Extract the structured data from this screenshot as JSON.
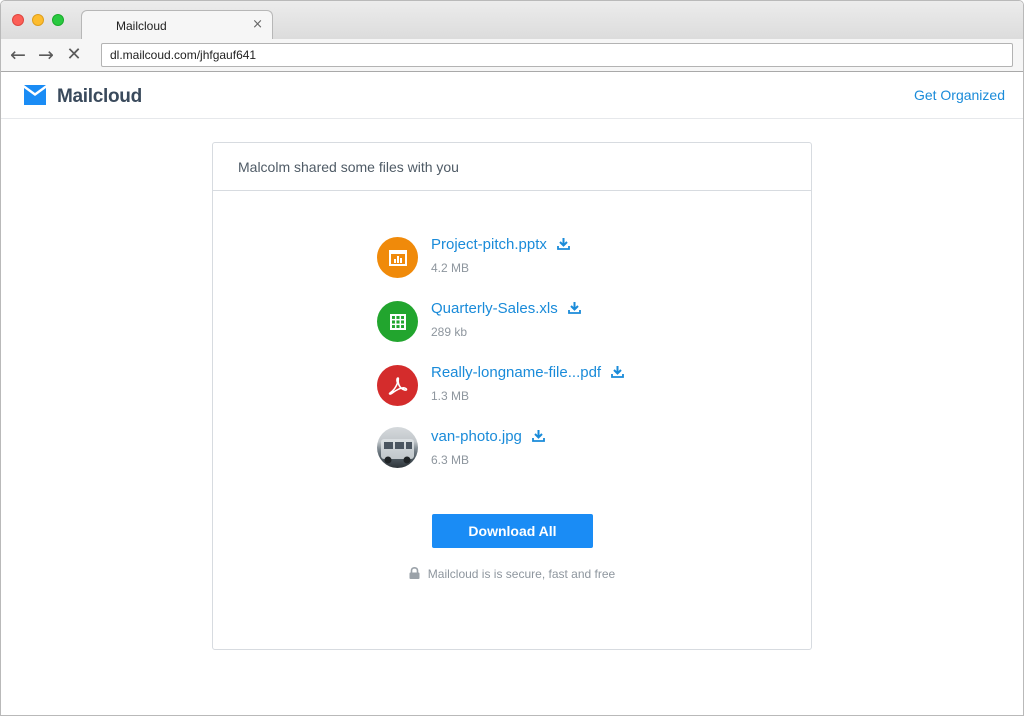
{
  "browser": {
    "tab_title": "Mailcloud",
    "tab_close": "×",
    "url": "dl.mailcoud.com/jhfgauf641",
    "nav": {
      "back": "←",
      "forward": "→",
      "stop": "✕"
    }
  },
  "header": {
    "brand": "Mailcloud",
    "link": "Get Organized",
    "accent_color": "#1a8bd9"
  },
  "card": {
    "title": "Malcolm shared some files with you",
    "files": [
      {
        "name": "Project-pitch.pptx",
        "size": "4.2 MB",
        "icon": "presentation-icon",
        "color": "#f08a0a"
      },
      {
        "name": "Quarterly-Sales.xls",
        "size": "289 kb",
        "icon": "spreadsheet-icon",
        "color": "#22a52e"
      },
      {
        "name": "Really-longname-file...pdf",
        "size": "1.3 MB",
        "icon": "pdf-icon",
        "color": "#d42c2c"
      },
      {
        "name": "van-photo.jpg",
        "size": "6.3 MB",
        "icon": "photo-thumbnail",
        "color": "#7b858d"
      }
    ],
    "download_all": "Download All",
    "secure_note": "Mailcloud is is secure, fast and free"
  }
}
